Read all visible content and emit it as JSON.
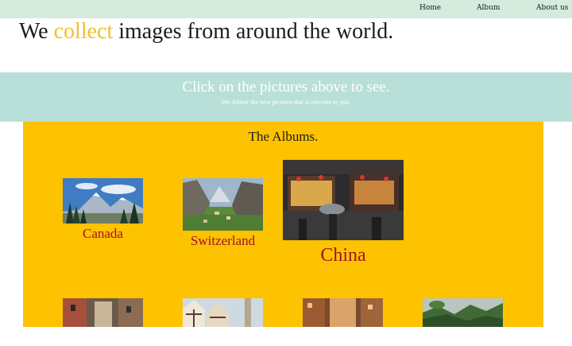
{
  "nav": {
    "items": [
      {
        "label": "Home"
      },
      {
        "label": "Album"
      },
      {
        "label": "About us"
      }
    ]
  },
  "hero": {
    "title_before": "We",
    "title_accent": "collect",
    "title_after": "images from around the world."
  },
  "banner": {
    "title": "Click on the pictures above to see.",
    "subtitle": "We deliver the new pictures that is relevant to you."
  },
  "albums": {
    "heading": "The Albums.",
    "items": [
      {
        "label": "Canada",
        "icon": "canada-mountains-photo"
      },
      {
        "label": "Switzerland",
        "icon": "switzerland-valley-photo"
      },
      {
        "label": "China",
        "icon": "china-street-photo"
      }
    ],
    "row2": [
      {
        "icon": "old-town-alley-photo"
      },
      {
        "icon": "timber-houses-photo"
      },
      {
        "icon": "narrow-street-photo"
      },
      {
        "icon": "jungle-valley-photo"
      }
    ]
  },
  "colors": {
    "nav_bg": "#d4ebde",
    "banner_bg": "#b9e0d8",
    "albums_bg": "#fdc200",
    "accent": "#f2c02a",
    "album_label": "#a1122a"
  }
}
